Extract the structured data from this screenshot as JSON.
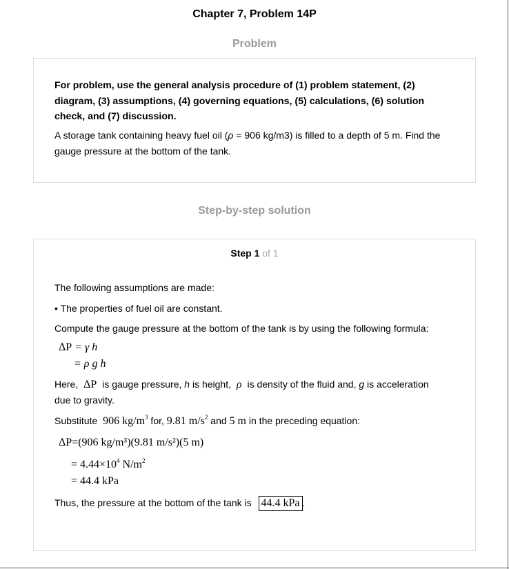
{
  "header": {
    "title": "Chapter 7, Problem 14P"
  },
  "problem": {
    "heading": "Problem",
    "instruction": "For problem, use the general analysis procedure of (1) problem statement, (2) diagram, (3) assumptions, (4) governing equations, (5) calculations, (6) solution check, and (7) discussion.",
    "text_before": "A storage tank containing heavy fuel oil (",
    "rho_symbol": "ρ",
    "text_after": " = 906 kg/m3) is filled to a depth of 5 m. Find the gauge pressure at the bottom of the tank."
  },
  "solution": {
    "heading": "Step-by-step solution",
    "step_label": "Step 1",
    "step_of": " of 1",
    "assumptions_intro": "The following assumptions are made:",
    "assumption_1": "• The properties of fuel oil are constant.",
    "compute_text": "Compute the gauge pressure at the bottom of the tank is by using the following formula:",
    "formula_line1_lhs": "ΔP",
    "formula_line1_rhs": "= γ h",
    "formula_line2": "= ρ g h",
    "here_1": "Here,",
    "here_dp": "ΔP",
    "here_2": " is gauge pressure, ",
    "here_h": "h",
    "here_3": " is height, ",
    "here_rho": "ρ",
    "here_4": " is density of the fluid and, ",
    "here_g": "g",
    "here_5": " is acceleration",
    "here_line2": "due to gravity.",
    "subst_1": "Substitute",
    "subst_v1": "906 kg/m",
    "subst_2": " for, ",
    "subst_v2": "9.81 m/s",
    "subst_3": " and ",
    "subst_v3": "5 m",
    "subst_4": " in the preceding equation:",
    "calc_line1": "ΔP=(906 kg/m³)(9.81 m/s²)(5 m)",
    "calc_line2_a": "= 4.44×10",
    "calc_line2_b": " N/m",
    "calc_line3": "= 44.4 kPa",
    "conclusion": "Thus, the pressure at the bottom of the tank is",
    "answer": "44.4 kPa",
    "period": "."
  }
}
